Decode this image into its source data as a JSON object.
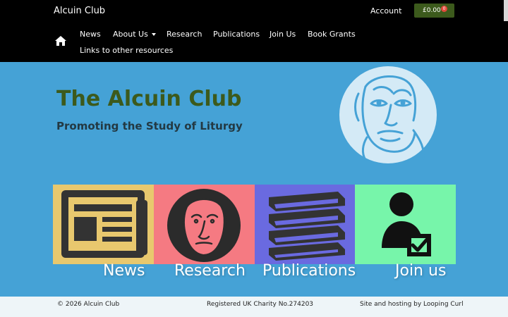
{
  "header": {
    "site_name": "Alcuin Club",
    "account_label": "Account",
    "cart_total": "£0.00",
    "cart_count": "0"
  },
  "nav": {
    "home_icon": "home-icon",
    "items": [
      {
        "label": "News"
      },
      {
        "label": "About Us",
        "has_dropdown": true
      },
      {
        "label": "Research"
      },
      {
        "label": "Publications"
      },
      {
        "label": "Join Us"
      },
      {
        "label": "Book Grants"
      },
      {
        "label": "Links to other resources"
      }
    ]
  },
  "hero": {
    "title": "The Alcuin Club",
    "subtitle": "Promoting the Study of Liturgy"
  },
  "tiles": [
    {
      "label": "News",
      "icon": "newspaper-icon",
      "color": "#e8c86e"
    },
    {
      "label": "Research",
      "icon": "portrait-icon",
      "color": "#f57a82"
    },
    {
      "label": "Publications",
      "icon": "books-icon",
      "color": "#6a6ae0"
    },
    {
      "label": "Join us",
      "icon": "member-check-icon",
      "color": "#77f5aa"
    }
  ],
  "footer": {
    "copyright": "© 2026 Alcuin Club",
    "charity": "Registered UK Charity No.274203",
    "credit": "Site and hosting by Looping Curl"
  },
  "colors": {
    "hero_bg": "#45a2d6",
    "header_bg": "#000000",
    "title_green": "#3c5a1c",
    "cart_bg": "#3c5a1c"
  }
}
